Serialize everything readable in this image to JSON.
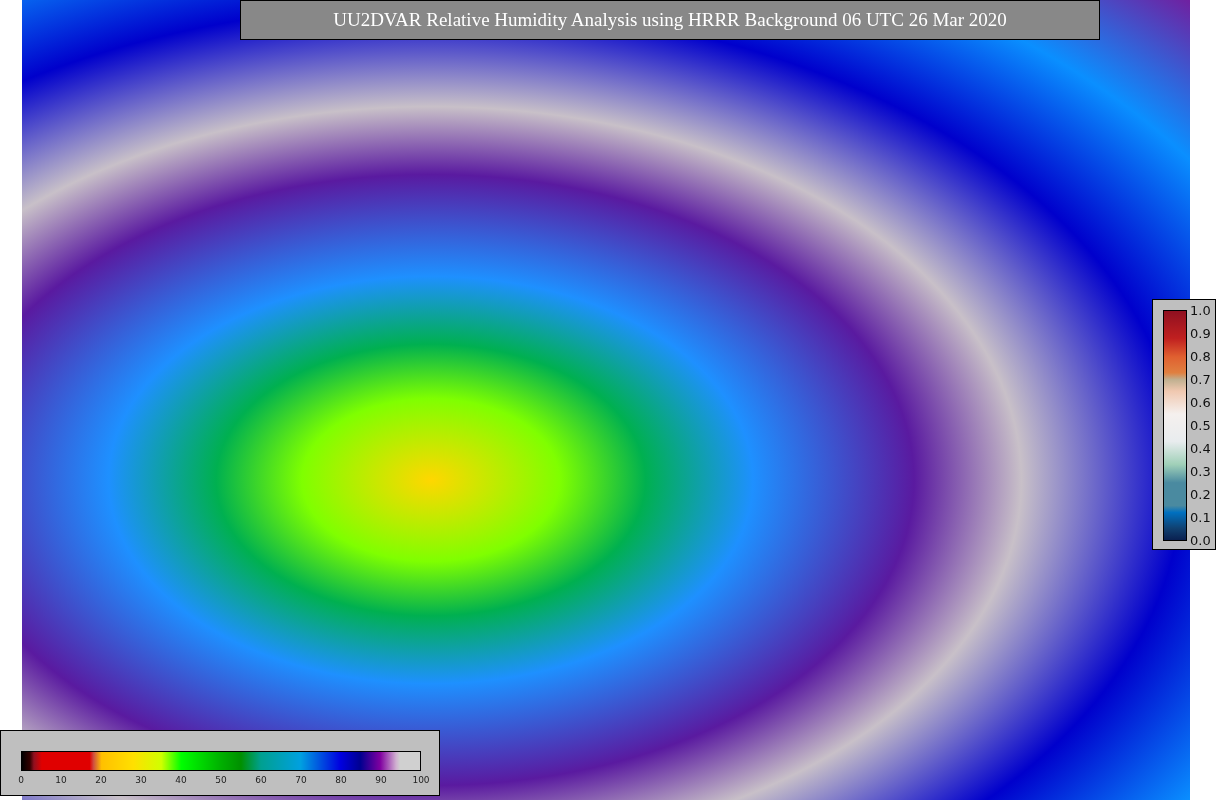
{
  "title": "UU2DVAR Relative Humidity Analysis using HRRR Background 06 UTC 26 Mar 2020",
  "humidity_colorbar": {
    "ticks": [
      "0",
      "10",
      "20",
      "30",
      "40",
      "50",
      "60",
      "70",
      "80",
      "90",
      "100"
    ]
  },
  "station_colorbar": {
    "ticks": [
      "1.0",
      "0.9",
      "0.8",
      "0.7",
      "0.6",
      "0.5",
      "0.4",
      "0.3",
      "0.2",
      "0.1",
      "0.0"
    ]
  }
}
